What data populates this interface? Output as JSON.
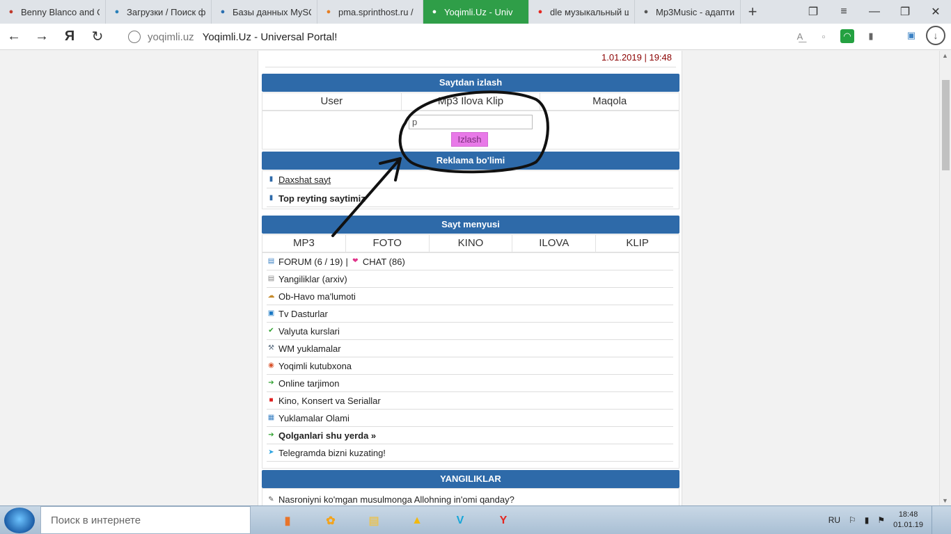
{
  "browser": {
    "tabs": [
      {
        "title": "Benny Blanco and C",
        "icon": "record-icon",
        "color": "#c0392b"
      },
      {
        "title": "Загрузки / Поиск ф",
        "icon": "loading-icon",
        "color": "#2980b9"
      },
      {
        "title": "Базы данных MySQ",
        "icon": "mysql-icon",
        "color": "#2a6fb0"
      },
      {
        "title": "pma.sprinthost.ru /",
        "icon": "phpmyadmin-icon",
        "color": "#e67e22"
      },
      {
        "title": "Yoqimli.Uz - Univ",
        "icon": "uz-flag-icon",
        "color": "#ffffff",
        "active": true
      },
      {
        "title": "dle музыкальный ш",
        "icon": "yandex-icon",
        "color": "#e52620"
      },
      {
        "title": "Mp3Music - адапти",
        "icon": "document-icon",
        "color": "#555555"
      }
    ],
    "new_tab": "+",
    "address": {
      "domain": "yoqimli.uz",
      "page_title": "Yoqimli.Uz - Universal Portal!"
    },
    "nav": {
      "back": "←",
      "forward": "→",
      "yandex": "Я",
      "reload": "↻"
    }
  },
  "page": {
    "datetime": "1.01.2019 | 19:48",
    "search_section": {
      "title": "Saytdan izlash",
      "tabs": [
        "User",
        "Mp3 Ilova Klip",
        "Maqola"
      ],
      "input_value": "p",
      "button": "Izlash"
    },
    "ads_section": {
      "title": "Reklama bo'limi",
      "items": [
        {
          "label": "Daxshat sayt",
          "style": "link"
        },
        {
          "label": "Top reyting saytimiz",
          "style": "bold"
        }
      ]
    },
    "menu_section": {
      "title": "Sayt menyusi",
      "tabs": [
        "MP3",
        "FOTO",
        "KINO",
        "ILOVA",
        "KLIP"
      ],
      "forum": "FORUM (6 / 19)",
      "separator": "|",
      "chat": "CHAT (86)",
      "items": [
        {
          "label": "Yangiliklar (arxiv)",
          "icon": "news-icon",
          "style": "normal"
        },
        {
          "label": "Ob-Havo ma'lumoti",
          "icon": "weather-icon",
          "style": "normal"
        },
        {
          "label": "Tv Dasturlar",
          "icon": "tv-icon",
          "style": "normal"
        },
        {
          "label": "Valyuta kurslari",
          "icon": "checkmark-icon",
          "style": "normal"
        },
        {
          "label": "WM yuklamalar",
          "icon": "tools-icon",
          "style": "normal"
        },
        {
          "label": "Yoqimli kutubxona",
          "icon": "library-icon",
          "style": "normal"
        },
        {
          "label": "Online tarjimon",
          "icon": "arrow-right-icon",
          "style": "normal"
        },
        {
          "label": "Kino, Konsert va Seriallar",
          "icon": "video-icon",
          "style": "normal"
        },
        {
          "label": "Yuklamalar Olami",
          "icon": "grid-icon",
          "style": "normal"
        },
        {
          "label": "Qolganlari shu yerda »",
          "icon": "arrow-right-icon",
          "style": "bold"
        },
        {
          "label": "Telegramda bizni kuzating!",
          "icon": "telegram-icon",
          "style": "normal"
        }
      ]
    },
    "news_section": {
      "title": "YANGILIKLAR",
      "first_item": "Nasroniyni ko'mgan musulmonga Allohning in'omi qanday?"
    }
  },
  "taskbar": {
    "search_placeholder": "Поиск в интернете",
    "apps": [
      {
        "name": "app-1",
        "glyph": "▮",
        "color": "#e8742a"
      },
      {
        "name": "fl-studio",
        "glyph": "✿",
        "color": "#f3a31b"
      },
      {
        "name": "explorer",
        "glyph": "▤",
        "color": "#e7c35a"
      },
      {
        "name": "aimp",
        "glyph": "▲",
        "color": "#f2b90f"
      },
      {
        "name": "vegas",
        "glyph": "V",
        "color": "#17a6d8"
      },
      {
        "name": "yandex-browser",
        "glyph": "Y",
        "color": "#e52620"
      }
    ],
    "lang": "RU",
    "time": "18:48",
    "date": "01.01.19"
  },
  "colors": {
    "header_blue": "#2e6aa9",
    "search_button": "#e879e8",
    "date_red": "#8b0000",
    "active_tab": "#2f9e48"
  }
}
